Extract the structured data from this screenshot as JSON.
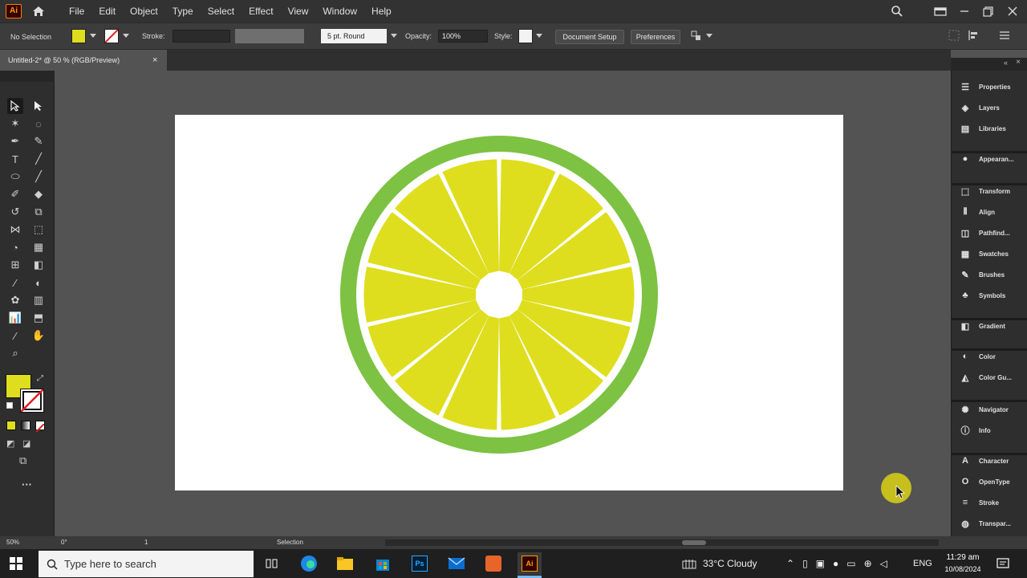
{
  "app": {
    "logo": "Ai"
  },
  "menu": [
    "File",
    "Edit",
    "Object",
    "Type",
    "Select",
    "Effect",
    "View",
    "Window",
    "Help"
  ],
  "control_bar": {
    "selection_label": "No Selection",
    "fill_color": "#dede1e",
    "stroke_label": "Stroke:",
    "brush_label": "5 pt. Round",
    "opacity_label": "Opacity:",
    "opacity_value": "100%",
    "style_label": "Style:",
    "document_setup": "Document Setup",
    "preferences": "Preferences"
  },
  "document_tab": {
    "title": "Untitled-2* @ 50 % (RGB/Preview)",
    "close": "×"
  },
  "right_panel": {
    "items": [
      {
        "label": "Properties",
        "icon": "properties-icon"
      },
      {
        "label": "Layers",
        "icon": "layers-icon"
      },
      {
        "label": "Libraries",
        "icon": "libraries-icon"
      },
      {
        "label": "Appearan...",
        "icon": "appearance-icon"
      },
      {
        "label": "Transform",
        "icon": "transform-icon"
      },
      {
        "label": "Align",
        "icon": "align-icon"
      },
      {
        "label": "Pathfind...",
        "icon": "pathfinder-icon"
      },
      {
        "label": "Swatches",
        "icon": "swatches-icon"
      },
      {
        "label": "Brushes",
        "icon": "brushes-icon"
      },
      {
        "label": "Symbols",
        "icon": "symbols-icon"
      },
      {
        "label": "Gradient",
        "icon": "gradient-icon"
      },
      {
        "label": "Color",
        "icon": "color-icon"
      },
      {
        "label": "Color Gu...",
        "icon": "color-guide-icon"
      },
      {
        "label": "Navigator",
        "icon": "navigator-icon"
      },
      {
        "label": "Info",
        "icon": "info-icon"
      },
      {
        "label": "Character",
        "icon": "character-icon"
      },
      {
        "label": "OpenType",
        "icon": "opentype-icon"
      },
      {
        "label": "Stroke",
        "icon": "stroke-icon"
      },
      {
        "label": "Transpar...",
        "icon": "transparency-icon"
      }
    ]
  },
  "status_bar": {
    "zoom": "50%",
    "rotation": "0°",
    "artboard": "1",
    "tool": "Selection"
  },
  "artwork": {
    "rind_color": "#7dc242",
    "pith_color": "#ffffff",
    "flesh_color": "#dede1e",
    "segments": 14
  },
  "taskbar": {
    "search_placeholder": "Type here to search",
    "weather": "33°C  Cloudy",
    "language": "ENG",
    "time": "11:29 am",
    "date": "10/08/2024"
  }
}
